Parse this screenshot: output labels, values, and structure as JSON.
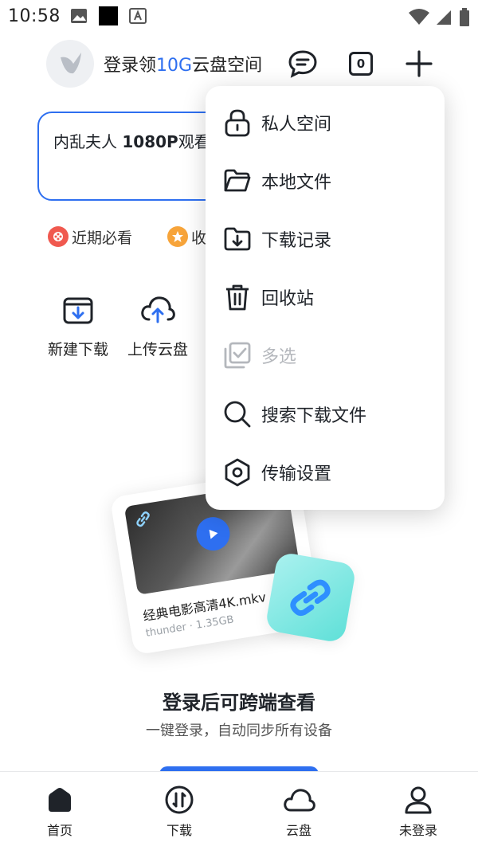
{
  "status_bar": {
    "time": "10:58"
  },
  "header": {
    "login_prefix": "登录领",
    "login_highlight": "10G",
    "login_suffix": "云盘空间",
    "task_count": "0"
  },
  "search": {
    "text_normal": "内乱夫人 ",
    "text_bold": "1080P",
    "text_tail": "观看"
  },
  "chips": [
    {
      "label": "近期必看",
      "color": "#f0594f"
    },
    {
      "label": "收",
      "color": "#f7a43a"
    }
  ],
  "quick_actions": [
    {
      "label": "新建下载"
    },
    {
      "label": "上传云盘"
    }
  ],
  "illustration": {
    "file_name": "经典电影高清4K.mkv",
    "file_meta": "thunder · 1.35GB"
  },
  "promo": {
    "title": "登录后可跨端查看",
    "subtitle": "一键登录，自动同步所有设备"
  },
  "menu": {
    "items": [
      {
        "label": "私人空间",
        "icon": "lock-icon"
      },
      {
        "label": "本地文件",
        "icon": "folder-icon"
      },
      {
        "label": "下载记录",
        "icon": "download-record-icon"
      },
      {
        "label": "回收站",
        "icon": "trash-icon"
      },
      {
        "label": "多选",
        "icon": "multi-select-icon",
        "disabled": true
      },
      {
        "label": "搜索下载文件",
        "icon": "search-icon"
      },
      {
        "label": "传输设置",
        "icon": "settings-icon"
      }
    ]
  },
  "tabs": [
    {
      "label": "首页",
      "icon": "home-icon",
      "active": true
    },
    {
      "label": "下载",
      "icon": "download-icon"
    },
    {
      "label": "云盘",
      "icon": "cloud-icon"
    },
    {
      "label": "未登录",
      "icon": "user-icon"
    }
  ],
  "colors": {
    "accent": "#2e6ff0",
    "text": "#1f2329",
    "muted": "#b4b7bc"
  }
}
